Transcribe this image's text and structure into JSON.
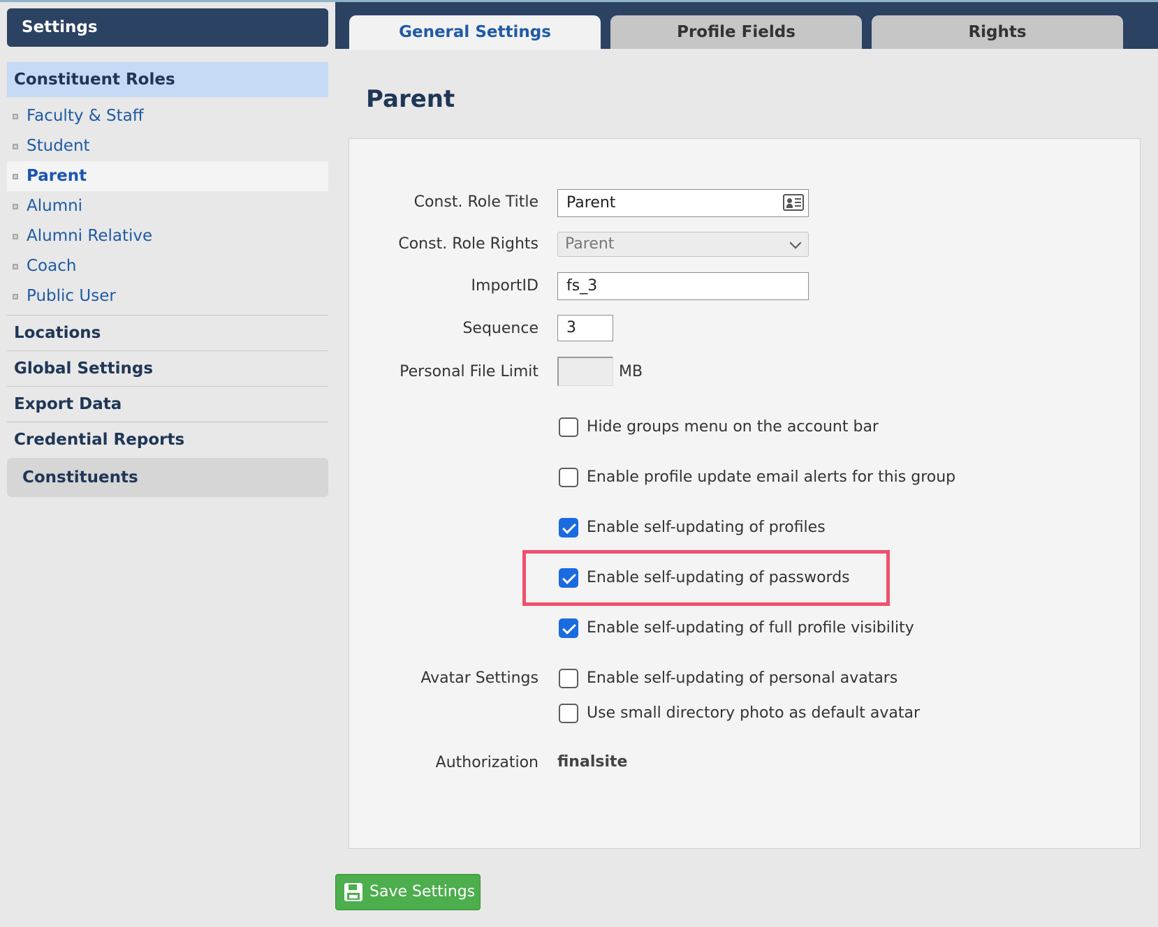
{
  "sidebar": {
    "header": "Settings",
    "active_section": "Constituent Roles",
    "items": [
      {
        "label": "Faculty & Staff"
      },
      {
        "label": "Student"
      },
      {
        "label": "Parent"
      },
      {
        "label": "Alumni"
      },
      {
        "label": "Alumni Relative"
      },
      {
        "label": "Coach"
      },
      {
        "label": "Public User"
      }
    ],
    "selected_item": "Parent",
    "sections": [
      "Locations",
      "Global Settings",
      "Export Data",
      "Credential Reports"
    ],
    "constituents": "Constituents"
  },
  "tabs": [
    {
      "label": "General Settings"
    },
    {
      "label": "Profile Fields"
    },
    {
      "label": "Rights"
    }
  ],
  "active_tab": "General Settings",
  "page_title": "Parent",
  "form": {
    "role_title_label": "Const. Role Title",
    "role_title_value": "Parent",
    "role_rights_label": "Const. Role Rights",
    "role_rights_value": "Parent",
    "import_id_label": "ImportID",
    "import_id_value": "fs_3",
    "sequence_label": "Sequence",
    "sequence_value": "3",
    "file_limit_label": "Personal File Limit",
    "file_limit_value": "",
    "file_limit_unit": "MB",
    "avatar_label": "Avatar Settings",
    "auth_label": "Authorization",
    "auth_value": "finalsite"
  },
  "checkboxes": [
    {
      "label": "Hide groups menu on the account bar",
      "checked": false
    },
    {
      "label": "Enable profile update email alerts for this group",
      "checked": false
    },
    {
      "label": "Enable self-updating of profiles",
      "checked": true
    },
    {
      "label": "Enable self-updating of passwords",
      "checked": true
    },
    {
      "label": "Enable self-updating of full profile visibility",
      "checked": true
    },
    {
      "label": "Enable self-updating of personal avatars",
      "checked": false
    },
    {
      "label": "Use small directory photo as default avatar",
      "checked": false
    }
  ],
  "save_button": "Save Settings",
  "colors": {
    "nav_dark": "#2c4262",
    "link_blue": "#1f5aa6",
    "check_blue": "#1a6ae0",
    "highlight": "#f0506e",
    "save_green": "#4cae4c"
  }
}
